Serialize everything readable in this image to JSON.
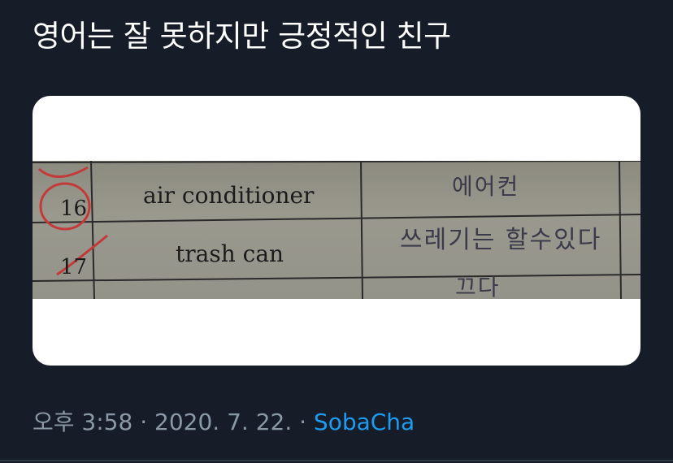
{
  "tweet": {
    "text": "영어는 잘 못하지만 긍정적인 친구"
  },
  "worksheet": {
    "rows": [
      {
        "number": "16",
        "word": "air conditioner",
        "answer": "에어컨"
      },
      {
        "number": "17",
        "word": "trash can",
        "answer": "쓰레기는 할수있다"
      },
      {
        "number": "",
        "word": "",
        "answer": "끄다"
      }
    ]
  },
  "meta": {
    "time": "오후 3:58",
    "sep1": " · ",
    "date": "2020. 7. 22.",
    "sep2": " · ",
    "source": "SobaCha"
  },
  "colors": {
    "background": "#161d29",
    "meta_text": "#8b98a5",
    "link": "#1d9bf0",
    "red_pen": "#c43a3a"
  }
}
